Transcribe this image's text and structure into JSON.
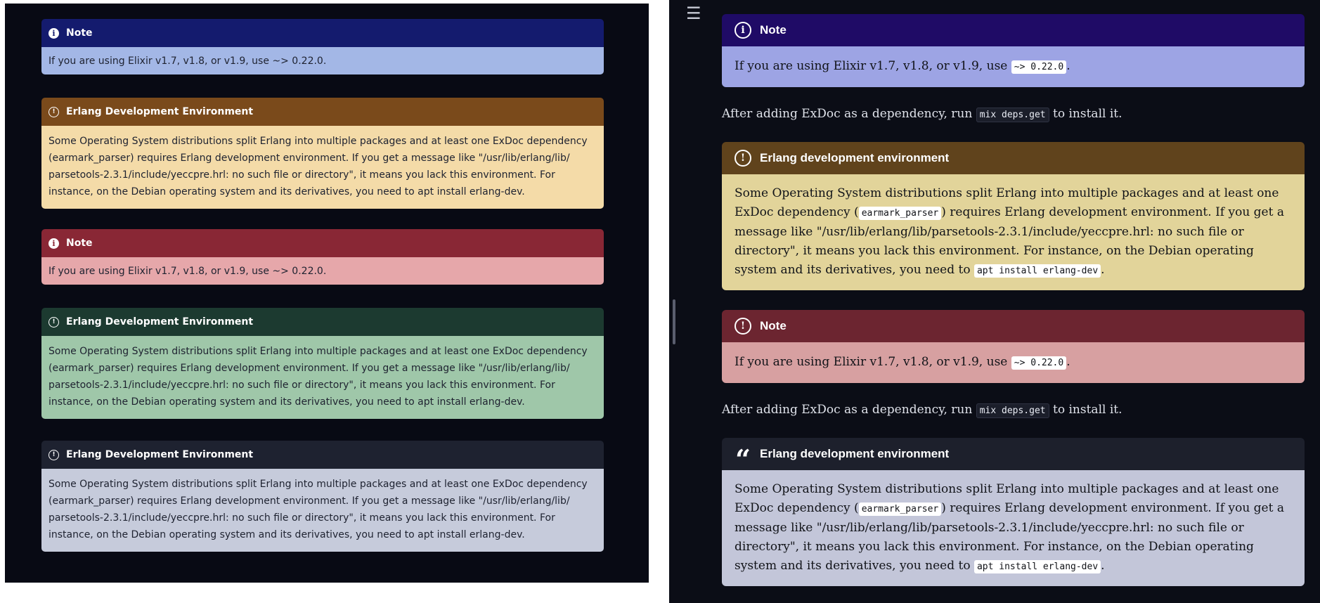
{
  "left": {
    "callouts": [
      {
        "title": "Note",
        "icon": "info-icon",
        "text": "If you are using Elixir v1.7, v1.8, or v1.9, use ~> 0.22.0.",
        "header_color": "#141b6e",
        "body_color": "#a3b7e6"
      },
      {
        "title": "Erlang Development Environment",
        "icon": "exclamation-icon",
        "text": "Some Operating System distributions split Erlang into multiple packages and at least one ExDoc dependency (earmark_parser) requires Erlang development environment. If you get a message like \"/usr/lib/erlang/lib/ parsetools-2.3.1/include/yeccpre.hrl: no such file or directory\", it means you lack this environment. For instance, on the Debian operating system and its derivatives, you need to apt install erlang-dev.",
        "header_color": "#7a4a1b",
        "body_color": "#f4dba8"
      },
      {
        "title": "Note",
        "icon": "info-icon",
        "text": "If you are using Elixir v1.7, v1.8, or v1.9, use ~> 0.22.0.",
        "header_color": "#892735",
        "body_color": "#e6a7aa"
      },
      {
        "title": "Erlang Development Environment",
        "icon": "exclamation-icon",
        "text": "Some Operating System distributions split Erlang into multiple packages and at least one ExDoc dependency (earmark_parser) requires Erlang development environment. If you get a message like \"/usr/lib/erlang/lib/ parsetools-2.3.1/include/yeccpre.hrl: no such file or directory\", it means you lack this environment. For instance, on the Debian operating system and its derivatives, you need to apt install erlang-dev.",
        "header_color": "#1c3a30",
        "body_color": "#9fc7a9"
      },
      {
        "title": "Erlang Development Environment",
        "icon": "exclamation-icon",
        "text": "Some Operating System distributions split Erlang into multiple packages and at least one ExDoc dependency (earmark_parser) requires Erlang development environment. If you get a message like \"/usr/lib/erlang/lib/ parsetools-2.3.1/include/yeccpre.hrl: no such file or directory\", it means you lack this environment. For instance, on the Debian operating system and its derivatives, you need to apt install erlang-dev.",
        "header_color": "#1e2230",
        "body_color": "#c6cbdb"
      }
    ]
  },
  "right": {
    "menu_icon": "☰",
    "note1": {
      "title": "Note",
      "icon": "info-icon",
      "prefix": "If you are using Elixir v1.7, v1.8, or v1.9, use",
      "code": "~> 0.22.0",
      "suffix": ".",
      "header_color": "#1f0b66",
      "body_color": "#9da4e4"
    },
    "para1": {
      "prefix": "After adding ExDoc as a dependency, run",
      "code": "mix deps.get",
      "suffix": "to install it."
    },
    "erlang1": {
      "title": "Erlang development environment",
      "icon": "exclamation-icon",
      "t1": "Some Operating System distributions split Erlang into multiple packages and at least one ExDoc dependency (",
      "code1": "earmark_parser",
      "t2": ") requires Erlang development environment. If you get a message like \"/usr/lib/erlang/lib/parsetools-2.3.1/include/yeccpre.hrl: no such file or directory\", it means you lack this environment. For instance, on the Debian operating system and its derivatives, you need to",
      "code2": "apt install erlang-dev",
      "t3": ".",
      "header_color": "#60431c",
      "body_color": "#e2d49a"
    },
    "note2": {
      "title": "Note",
      "icon": "exclamation-icon",
      "prefix": "If you are using Elixir v1.7, v1.8, or v1.9, use",
      "code": "~> 0.22.0",
      "suffix": ".",
      "header_color": "#6c2530",
      "body_color": "#d7a0a1"
    },
    "para2": {
      "prefix": "After adding ExDoc as a dependency, run",
      "code": "mix deps.get",
      "suffix": "to install it."
    },
    "erlang2": {
      "title": "Erlang development environment",
      "icon": "quote-icon",
      "t1": "Some Operating System distributions split Erlang into multiple packages and at least one ExDoc dependency (",
      "code1": "earmark_parser",
      "t2": ") requires Erlang development environment. If you get a message like \"/usr/lib/erlang/lib/parsetools-2.3.1/include/yeccpre.hrl: no such file or directory\", it means you lack this environment. For instance, on the Debian operating system and its derivatives, you need to",
      "code2": "apt install erlang-dev",
      "t3": ".",
      "header_color": "#1d202c",
      "body_color": "#c3c6d9"
    }
  }
}
